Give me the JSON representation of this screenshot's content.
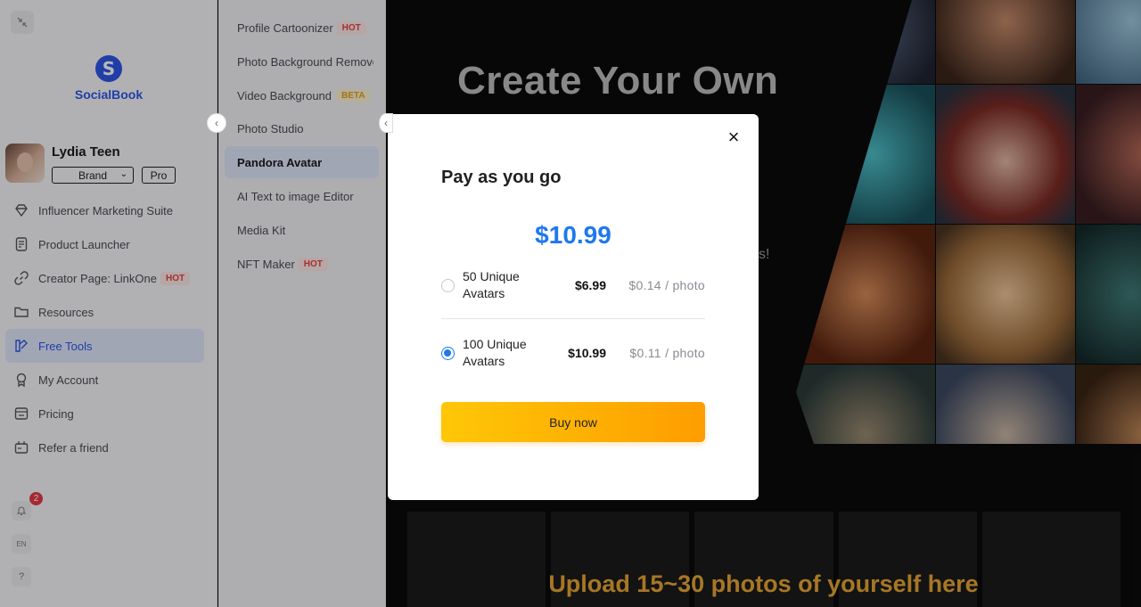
{
  "brand": {
    "name": "SocialBook",
    "logo_letter": "S"
  },
  "profile": {
    "name": "Lydia Teen",
    "account_type": "Brand",
    "plan": "Pro"
  },
  "sidebar": {
    "items": [
      {
        "label": "Influencer Marketing Suite",
        "icon": "diamond-icon"
      },
      {
        "label": "Product Launcher",
        "icon": "document-icon"
      },
      {
        "label": "Creator Page: LinkOne",
        "icon": "link-icon",
        "tag": "HOT"
      },
      {
        "label": "Resources",
        "icon": "folder-icon"
      },
      {
        "label": "Free Tools",
        "icon": "tools-icon",
        "active": true
      },
      {
        "label": "My Account",
        "icon": "account-icon"
      },
      {
        "label": "Pricing",
        "icon": "pricing-icon"
      },
      {
        "label": "Refer a friend",
        "icon": "gift-icon"
      }
    ],
    "notifications_count": "2",
    "language": "EN",
    "help": "?"
  },
  "tools": {
    "items": [
      {
        "label": "Profile Cartoonizer",
        "tag": "HOT"
      },
      {
        "label": "Photo Background Remover"
      },
      {
        "label": "Video Background Remover",
        "tag": "BETA"
      },
      {
        "label": "Photo Studio"
      },
      {
        "label": "Pandora Avatar",
        "active": true
      },
      {
        "label": "AI Text to image Editor"
      },
      {
        "label": "Media Kit"
      },
      {
        "label": "NFT Maker",
        "tag": "HOT"
      }
    ]
  },
  "hero": {
    "title": "Create Your Own",
    "fragment": "s!",
    "upload_title": "Upload 15~30 photos of yourself here"
  },
  "modal": {
    "title": "Pay as you go",
    "price": "$10.99",
    "options": [
      {
        "label": "50 Unique Avatars",
        "price": "$6.99",
        "per_photo": "$0.14 / photo",
        "selected": false
      },
      {
        "label": "100 Unique Avatars",
        "price": "$10.99",
        "per_photo": "$0.11 / photo",
        "selected": true
      }
    ],
    "buy_label": "Buy now",
    "close": "×"
  },
  "colors": {
    "accent": "#2f56e8",
    "price_blue": "#1e78f0",
    "buy_start": "#fec707",
    "buy_end": "#fe9d00",
    "hot": "#e44343",
    "upload_title": "#e8a534"
  }
}
